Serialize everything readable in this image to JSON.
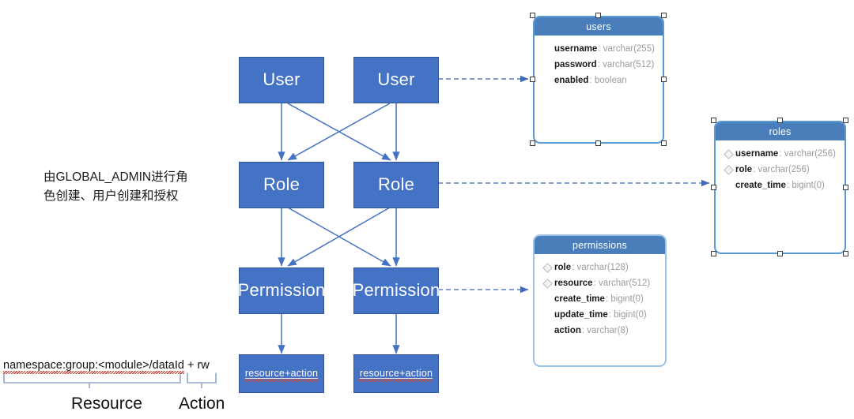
{
  "diagram": {
    "title": "RBAC permission model diagram",
    "colors": {
      "box_fill": "#4472C4",
      "box_border": "#2F5597",
      "table_header": "#4A7EBB",
      "table_border_selected": "#5B9BD5",
      "table_border_plain": "#9DC3E6",
      "arrow": "#4472C4",
      "dashed_arrow": "#5B7FC0",
      "bracket": "#8FA8C8",
      "spellcheck_underline": "#cc3b30"
    }
  },
  "note": {
    "text": "由GLOBAL_ADMIN进行角\n色创建、用户创建和授权"
  },
  "flow": {
    "boxes": [
      {
        "id": "user-left",
        "label": "User"
      },
      {
        "id": "user-right",
        "label": "User"
      },
      {
        "id": "role-left",
        "label": "Role"
      },
      {
        "id": "role-right",
        "label": "Role"
      },
      {
        "id": "permission-left",
        "label": "Permission"
      },
      {
        "id": "permission-right",
        "label": "Permission"
      },
      {
        "id": "resource-action-left",
        "label": "resource+action"
      },
      {
        "id": "resource-action-right",
        "label": "resource+action"
      }
    ]
  },
  "pattern": {
    "misspelled_part": "namespace:group:<module>/dataId",
    "suffix": " + rw",
    "resource_label": "Resource",
    "action_label": "Action"
  },
  "tables": [
    {
      "id": "users",
      "name": "users",
      "selected": true,
      "fields": [
        {
          "name": "username",
          "type": "varchar(255)",
          "key": false
        },
        {
          "name": "password",
          "type": "varchar(512)",
          "key": false
        },
        {
          "name": "enabled",
          "type": "boolean",
          "key": false
        }
      ]
    },
    {
      "id": "roles",
      "name": "roles",
      "selected": true,
      "fields": [
        {
          "name": "username",
          "type": "varchar(256)",
          "key": true
        },
        {
          "name": "role",
          "type": "varchar(256)",
          "key": true
        },
        {
          "name": "create_time",
          "type": "bigint(0)",
          "key": false
        }
      ]
    },
    {
      "id": "permissions",
      "name": "permissions",
      "selected": false,
      "fields": [
        {
          "name": "role",
          "type": "varchar(128)",
          "key": true
        },
        {
          "name": "resource",
          "type": "varchar(512)",
          "key": true
        },
        {
          "name": "create_time",
          "type": "bigint(0)",
          "key": false
        },
        {
          "name": "update_time",
          "type": "bigint(0)",
          "key": false
        },
        {
          "name": "action",
          "type": "varchar(8)",
          "key": false
        }
      ]
    }
  ],
  "connections": [
    {
      "id": "user-to-users-table",
      "style": "dashed"
    },
    {
      "id": "role-to-roles-table",
      "style": "dashed"
    },
    {
      "id": "permission-to-permissions-table",
      "style": "dashed"
    },
    {
      "id": "user-left-to-role-left",
      "style": "solid"
    },
    {
      "id": "user-left-to-role-right",
      "style": "solid"
    },
    {
      "id": "user-right-to-role-left",
      "style": "solid"
    },
    {
      "id": "user-right-to-role-right",
      "style": "solid"
    },
    {
      "id": "role-left-to-permission-left",
      "style": "solid"
    },
    {
      "id": "role-left-to-permission-right",
      "style": "solid"
    },
    {
      "id": "role-right-to-permission-left",
      "style": "solid"
    },
    {
      "id": "role-right-to-permission-right",
      "style": "solid"
    },
    {
      "id": "permission-left-to-resource-left",
      "style": "double"
    },
    {
      "id": "permission-right-to-resource-right",
      "style": "double"
    }
  ]
}
